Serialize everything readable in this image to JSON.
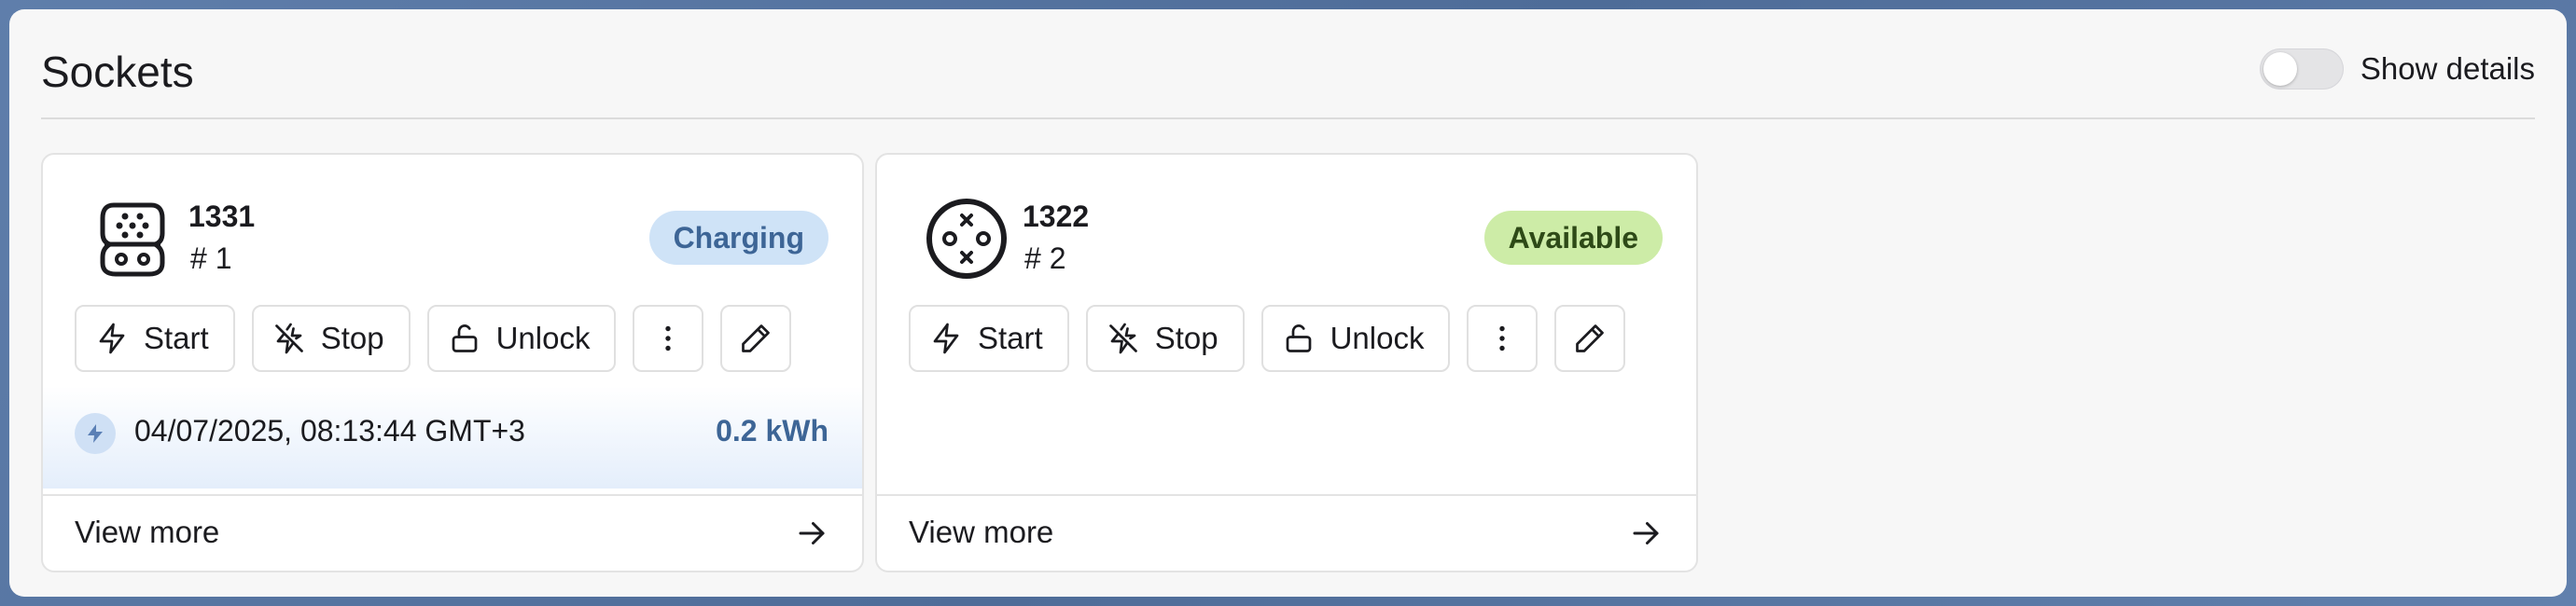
{
  "header": {
    "title": "Sockets",
    "toggle_label": "Show details",
    "toggle_on": false
  },
  "actions_labels": {
    "start": "Start",
    "stop": "Stop",
    "unlock": "Unlock"
  },
  "sockets": [
    {
      "id": "1331",
      "number": "# 1",
      "status": "Charging",
      "connector_icon": "type2-connector-icon",
      "session": {
        "time": "04/07/2025, 08:13:44 GMT+3",
        "energy": "0.2 kWh"
      },
      "footer": "View more"
    },
    {
      "id": "1322",
      "number": "# 2",
      "status": "Available",
      "connector_icon": "chademo-connector-icon",
      "footer": "View more"
    }
  ],
  "colors": {
    "charging_badge_bg": "#cfe3f7",
    "charging_badge_text": "#3d6596",
    "available_badge_bg": "#cdeca7",
    "available_badge_text": "#2e4a17"
  }
}
